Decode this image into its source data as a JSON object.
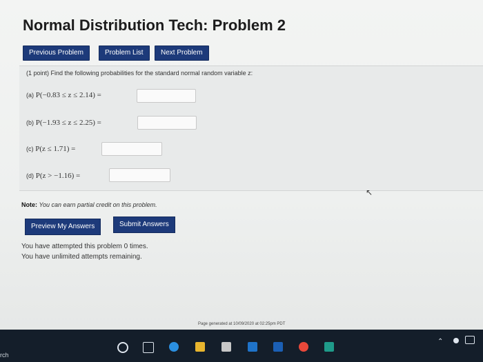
{
  "page": {
    "title": "Normal Distribution Tech: Problem 2",
    "nav": {
      "previous": "Previous Problem",
      "list": "Problem List",
      "next": "Next Problem"
    },
    "problem": {
      "intro": "(1 point) Find the following probabilities for the standard normal random variable z:",
      "parts": [
        {
          "label": "(a)",
          "expr": "P(−0.83 ≤ z ≤ 2.14) =",
          "value": ""
        },
        {
          "label": "(b)",
          "expr": "P(−1.93 ≤ z ≤ 2.25) =",
          "value": ""
        },
        {
          "label": "(c)",
          "expr": "P(z ≤ 1.71) =",
          "value": ""
        },
        {
          "label": "(d)",
          "expr": "P(z > −1.16) =",
          "value": ""
        }
      ]
    },
    "note": {
      "bold": "Note:",
      "text": "You can earn partial credit on this problem."
    },
    "buttons": {
      "preview": "Preview My Answers",
      "submit": "Submit Answers"
    },
    "attempts": {
      "line1": "You have attempted this problem 0 times.",
      "line2": "You have unlimited attempts remaining."
    },
    "footer": "Page generated at 10/09/2020 at 02:25pm PDT"
  },
  "taskbar": {
    "search_fragment": "rch"
  },
  "colors": {
    "button_bg": "#1d3a7a",
    "taskbar_bg": "#141e2a"
  }
}
